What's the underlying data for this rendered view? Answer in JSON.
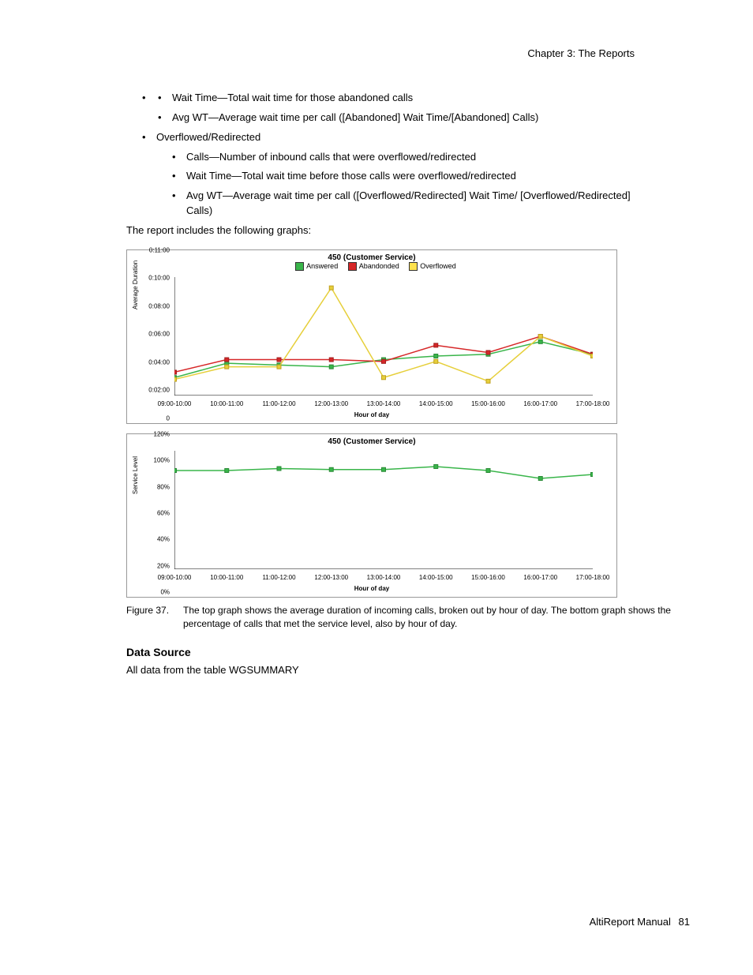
{
  "header": {
    "chapter": "Chapter 3:  The Reports"
  },
  "bullets": {
    "b1": "Wait Time—Total wait time for those abandoned calls",
    "b2": "Avg WT—Average wait time per call ([Abandoned] Wait Time/[Abandoned] Calls)",
    "outer2": "Overflowed/Redirected",
    "b3": "Calls—Number of inbound calls that were overflowed/redirected",
    "b4": "Wait Time—Total wait time before those calls were overflowed/redirected",
    "b5": "Avg WT—Average wait time per call ([Overflowed/Redirected] Wait Time/ [Overflowed/Redirected] Calls)"
  },
  "intro": "The report includes the following graphs:",
  "chart_data": [
    {
      "type": "line",
      "title": "450 (Customer Service)",
      "xlabel": "Hour of day",
      "ylabel": "Average Duration",
      "categories": [
        "09:00-10:00",
        "10:00-11:00",
        "11:00-12:00",
        "12:00-13:00",
        "13:00-14:00",
        "14:00-15:00",
        "15:00-16:00",
        "16:00-17:00",
        "17:00-18:00"
      ],
      "y_ticks": [
        "0",
        "0:02:00",
        "0:04:00",
        "0:06:00",
        "0:08:00",
        "0:10:00",
        "0:11:00"
      ],
      "ylim": [
        0,
        660
      ],
      "series": [
        {
          "name": "Answered",
          "color": "#39b54a",
          "values": [
            100,
            180,
            170,
            160,
            200,
            220,
            230,
            300,
            230
          ]
        },
        {
          "name": "Abandonded",
          "color": "#d62728",
          "values": [
            130,
            200,
            200,
            200,
            190,
            280,
            240,
            330,
            230
          ]
        },
        {
          "name": "Overflowed",
          "color": "#e6cf3a",
          "values": [
            90,
            160,
            160,
            600,
            100,
            190,
            80,
            330,
            220
          ]
        }
      ]
    },
    {
      "type": "line",
      "title": "450 (Customer Service)",
      "xlabel": "Hour of day",
      "ylabel": "Service Level",
      "categories": [
        "09:00-10:00",
        "10:00-11:00",
        "11:00-12:00",
        "12:00-13:00",
        "13:00-14:00",
        "14:00-15:00",
        "15:00-16:00",
        "16:00-17:00",
        "17:00-18:00"
      ],
      "y_ticks": [
        "0%",
        "20%",
        "40%",
        "60%",
        "80%",
        "100%",
        "120%"
      ],
      "ylim": [
        0,
        120
      ],
      "series": [
        {
          "name": "Service Level",
          "color": "#39b54a",
          "values": [
            100,
            100,
            102,
            101,
            101,
            104,
            100,
            92,
            96
          ]
        }
      ]
    }
  ],
  "legend": {
    "answered": "Answered",
    "abandoned": "Abandonded",
    "overflow": "Overflowed"
  },
  "figcap": {
    "num": "Figure 37.",
    "text": "The top graph shows the average duration of incoming calls, broken out by hour of day. The bottom graph shows the percentage of calls that met the service level, also by hour of day."
  },
  "datasource": {
    "heading": "Data Source",
    "text": "All data from the table WGSUMMARY"
  },
  "footer": {
    "manual": "AltiReport Manual",
    "page": "81"
  }
}
